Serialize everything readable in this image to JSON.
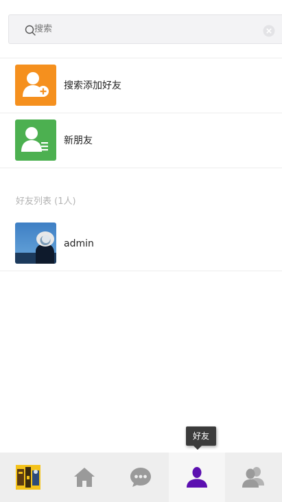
{
  "search": {
    "placeholder": "搜索",
    "value": ""
  },
  "actions": [
    {
      "label": "搜索添加好友",
      "color": "#f5901e",
      "icon": "add-user-icon"
    },
    {
      "label": "新朋友",
      "color": "#4cb050",
      "icon": "new-friend-list-icon"
    }
  ],
  "friends_section": {
    "title": "好友列表 (1人)"
  },
  "friends": [
    {
      "name": "admin",
      "avatar": "profile-photo"
    }
  ],
  "tooltip": {
    "text": "好友"
  },
  "tabbar": {
    "tabs": [
      {
        "id": "avatar",
        "icon": "profile-avatar-icon",
        "active": false
      },
      {
        "id": "home",
        "icon": "home-icon",
        "active": false
      },
      {
        "id": "chat",
        "icon": "chat-bubble-icon",
        "active": false
      },
      {
        "id": "friends",
        "icon": "person-icon",
        "active": true
      },
      {
        "id": "groups",
        "icon": "group-icon",
        "active": false
      }
    ],
    "active_color": "#5b0fb0",
    "inactive_color": "#9a9a9a"
  }
}
